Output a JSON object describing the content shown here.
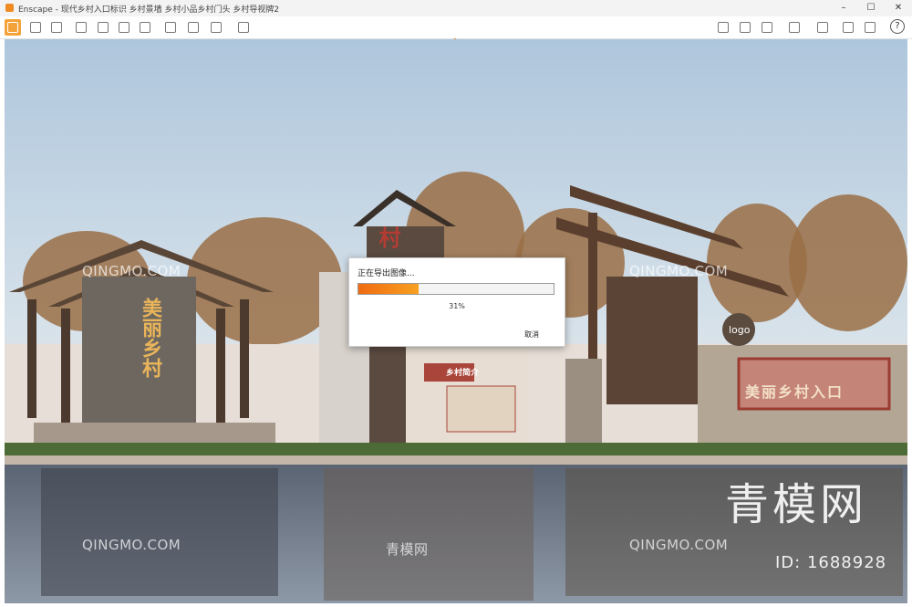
{
  "window": {
    "app_name": "Enscape",
    "title": "Enscape - 现代乡村入口标识 乡村景墙 乡村小品乡村门头 乡村导视牌2",
    "controls": [
      "minimize",
      "maximize",
      "close"
    ]
  },
  "toolbar": {
    "left_icons": [
      "home-icon",
      "measure-icon",
      "bim-icon",
      "list-icon",
      "binoculars-icon",
      "cube-icon",
      "building-icon",
      "book-icon",
      "video-editor-icon",
      "camera-icon",
      "batch-render-icon",
      "panorama-icon",
      "export-icon"
    ],
    "right_icons": [
      "map-icon",
      "asset-library-icon",
      "material-cube-icon",
      "atmosphere-icon",
      "capture-icon",
      "view-icon",
      "settings-icon",
      "help-icon"
    ],
    "help_label": "?"
  },
  "scene": {
    "sign_left": "美丽乡村",
    "sign_right": "美丽乡村入口",
    "sign_middle_small": "乡村简介",
    "sign_middle_big": "村",
    "logo_label": "logo"
  },
  "dialog": {
    "title": "正在导出图像...",
    "progress": 0.31,
    "progress_label": "31%",
    "cancel_label": "取消"
  },
  "watermarks": {
    "site": "QINGMO.COM",
    "brand": "青模网",
    "brand_big": "青模网",
    "id": "ID: 1688928"
  },
  "colors": {
    "accent": "#f08a22",
    "progress_start": "#f06b12",
    "progress_end": "#f8a020"
  }
}
